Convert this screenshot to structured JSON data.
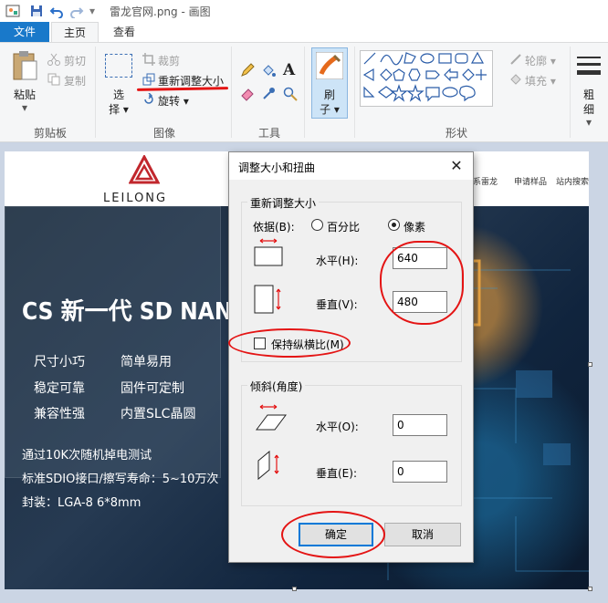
{
  "window": {
    "title": "雷龙官网.png - 画图"
  },
  "tabs": {
    "file": "文件",
    "home": "主页",
    "view": "查看"
  },
  "ribbon": {
    "clipboard": {
      "paste": "粘贴",
      "cut": "剪切",
      "copy": "复制",
      "group": "剪贴板"
    },
    "image": {
      "select_line1": "选",
      "select_line2": "择",
      "crop": "裁剪",
      "resize": "重新调整大小",
      "rotate": "旋转",
      "group": "图像"
    },
    "tools": {
      "group": "工具"
    },
    "brushes": {
      "line1": "刷",
      "line2": "子"
    },
    "shapes": {
      "outline": "轮廓",
      "fill": "填充",
      "group": "形状"
    },
    "size": {
      "line1": "粗",
      "line2": "细"
    }
  },
  "picture": {
    "logo_text": "LEILONG",
    "nav": [
      "系雷龙",
      "申请样品",
      "站内搜索"
    ],
    "hero_title": "CS 新一代 SD NAND",
    "features": [
      "尺寸小巧",
      "简单易用",
      "稳定可靠",
      "固件可定制",
      "兼容性强",
      "内置SLC晶圆"
    ],
    "specs": [
      "通过10K次随机掉电测试",
      "标准SDIO接口/擦写寿命：5~10万次",
      "封装：LGA-8 6*8mm"
    ]
  },
  "dialog": {
    "title": "调整大小和扭曲",
    "resize_group": "重新调整大小",
    "basis_label": "依据(B):",
    "percent_label": "百分比",
    "pixel_label": "像素",
    "horizontal_label": "水平(H):",
    "horizontal_value": "640",
    "vertical_label": "垂直(V):",
    "vertical_value": "480",
    "keep_ratio_label": "保持纵横比(M)",
    "skew_group": "倾斜(角度)",
    "skew_h_label": "水平(O):",
    "skew_h_value": "0",
    "skew_v_label": "垂直(E):",
    "skew_v_value": "0",
    "ok": "确定",
    "cancel": "取消"
  },
  "colors": {
    "accent": "#1979ca",
    "annotation": "#e41414",
    "dialog_bg": "#f0f0f0"
  }
}
